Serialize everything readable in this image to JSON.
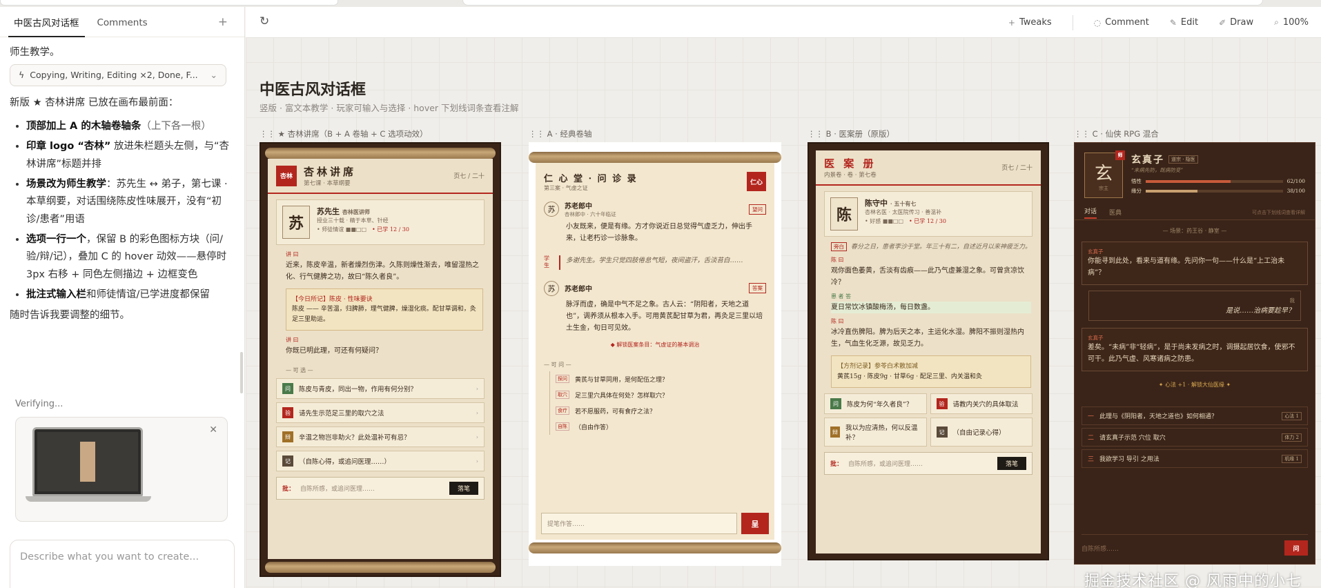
{
  "sidebar": {
    "tabs": [
      "中医古风对话框",
      "Comments"
    ],
    "tab_plus": "+",
    "chat_head": "师生教学。",
    "tooluse_label": "Copying, Writing, Editing ×2, Done, F...",
    "lead": "新版 ★ 杏林讲席 已放在画布最前面：",
    "bullets": [
      {
        "b": "顶部加上 A 的木轴卷轴条",
        "t": "（上下各一根）"
      },
      {
        "b": "印章 logo “杏林”",
        "t": " 放进朱栏题头左侧，与“杏林讲席”标题并排"
      },
      {
        "b": "场景改为师生教学",
        "t": "：苏先生 ↔ 弟子，第七课 · 本草纲要，对话围绕陈皮性味展开，没有“初诊/患者”用语"
      },
      {
        "b": "选项一行一个",
        "t": "，保留 B 的彩色图标方块（问/验/辩/记），叠加 C 的 hover 动效——悬停时 3px 右移 + 同色左侧描边 + 边框变色"
      },
      {
        "b": "批注式输入栏",
        "t": "和师徒情谊/已学进度都保留"
      }
    ],
    "closing": "随时告诉我要调整的细节。",
    "verifying": "Verifying...",
    "composer_placeholder": "Describe what you want to create..."
  },
  "toolbar": {
    "tweaks": "Tweaks",
    "comment": "Comment",
    "edit": "Edit",
    "draw": "Draw",
    "zoom": "100%"
  },
  "canvas": {
    "title": "中医古风对话框",
    "subtitle": "竖版 · 富文本教学 · 玩家可输入与选择 · hover 下划线词条查看注解",
    "labels": [
      "★ 杏林讲席（B + A 卷轴 + C 选项动效）",
      "A · 经典卷轴",
      "B · 医案册（原版）",
      "C · 仙侠 RPG 混合"
    ]
  },
  "artA": {
    "seal": "杏林",
    "title": "杏林讲席",
    "sub": "第七课 · 本草纲要",
    "page": "页七 / 二十",
    "pic": "苏",
    "pic_sub": "主讲",
    "name": "苏先生",
    "name_tag": "杏林医讲师",
    "desc": "授业三十载 · 精于本草、针经",
    "stat1": "• 师徒情谊 ■■□□",
    "stat2": "• 已学 12 / 30",
    "lbl1": "讲 曰",
    "text1": "近来，陈皮辛温，新者燥烈伤津。久陈则燥性渐去，唯留湿热之化、行气健脾之功，故曰“陈久者良”。",
    "note_title": "【今日所记】陈皮 · 性味要诀",
    "note_text": "陈皮 —— 辛苦温，归脾肺，理气健脾，燥湿化痰。配甘草调和，灸足三里助运。",
    "lbl2": "讲 曰",
    "text2": "你既已明此理，可还有何疑问？",
    "opts_head": "— 可 选 —",
    "opts": [
      {
        "k": "问",
        "t": "陈皮与青皮，同出一物，作用有何分别？",
        "c": "#4a7a4a"
      },
      {
        "k": "验",
        "t": "请先生示范足三里的取穴之法",
        "c": "#b3261e"
      },
      {
        "k": "辩",
        "t": "辛温之物岂非助火？此处温补可有忌？",
        "c": "#a07028"
      },
      {
        "k": "记",
        "t": "（自陈心得，或追问医理……）",
        "c": "#5a4a3a"
      }
    ],
    "input_label": "批：",
    "input_placeholder": "自陈所感，或追问医理……",
    "input_btn": "落笔"
  },
  "artB": {
    "title": "仁 心 堂 · 问 诊 录",
    "sub": "第三案 · 气虚之证",
    "seal": "仁心",
    "name1": "苏老郎中",
    "name1_sub": "杏林郎中 · 六十年临证",
    "tag1": "望问",
    "text1": "小友既来，便是有缘。方才你说近日总觉得气虚乏力，伸出手来，让老朽诊一诊脉象。",
    "stu_lbl": "学 生",
    "stu_text": "多谢先生。学生只觉四肢倦怠气短，夜间盗汗，舌淡苔白……",
    "name2": "苏老郎中",
    "tag2": "答案",
    "text2": "脉浮而虚，确是中气不足之象。古人云：“阴阳者，天地之道也”，调养须从根本入手。可用黄芪配甘草为君，再灸足三里以培土生金，旬日可见效。",
    "unlock": "◆ 解锁医案条目：气虚证的基本调治",
    "opts_head": "— 可 问 —",
    "opts": [
      {
        "k": "探问",
        "t": "黄芪与甘草同用，是何配伍之理？"
      },
      {
        "k": "取穴",
        "t": "足三里穴具体在何处？怎样取穴？"
      },
      {
        "k": "食疗",
        "t": "若不愿服药，可有食疗之法？"
      },
      {
        "k": "自陈",
        "t": "（自由作答）"
      }
    ],
    "input_placeholder": "提笔作答……",
    "input_btn": "呈"
  },
  "artC": {
    "title": "医 案 册",
    "sub": "内景卷 · 卷 · 第七卷",
    "page": "页七 / 二十",
    "pic": "陈",
    "name": "陈守中",
    "name_tag": "· 五十有七",
    "desc": "杏林名医 · 太医院传习 · 善温补",
    "stat1": "• 好感 ■■□□",
    "stat2": "• 已学 12 / 30",
    "tag_a": "旁白",
    "text_a": "春分之日，患者李沙于堂。年三十有二，自述近月以来神疲乏力。",
    "lbl1": "陈 曰",
    "text1": "观你面色萎黄，舌淡有齿痕——此乃气虚兼湿之象。可曾贪凉饮冷？",
    "lbl2": "患 者 答",
    "text2": "夏日常饮冰镇酸梅汤，每日数盏。",
    "lbl3": "陈 曰",
    "text3": "冰冷直伤脾阳。脾为后天之本，主运化水湿。脾阳不振则湿热内生，气血生化乏源，故见乏力。",
    "note_title": "【方剂记录】参苓白术散加减",
    "note_text": "黄芪15g · 陈皮9g · 甘草6g · 配足三里、内关温和灸",
    "opts": [
      {
        "k": "问",
        "t": "陈皮为何“年久者良”？",
        "c": "#4a7a4a"
      },
      {
        "k": "验",
        "t": "请教内关穴的具体取法",
        "c": "#b3261e"
      },
      {
        "k": "辩",
        "t": "我以为应清热，何以反温补？",
        "c": "#a07028"
      },
      {
        "k": "记",
        "t": "（自由记录心得）",
        "c": "#5a4a3a"
      }
    ],
    "input_label": "批：",
    "input_placeholder": "自陈所感，或追问医理……",
    "input_btn": "落笔"
  },
  "artD": {
    "pic": "玄",
    "pic_sub": "宗主",
    "badge": "师",
    "name": "玄真子",
    "name_tag": "道宗 · 隐医",
    "motto": "“未病先防，既病防变”",
    "bar1_lbl": "悟性",
    "bar1_val": "62/100",
    "bar1_pct": 62,
    "bar2_lbl": "缘分",
    "bar2_val": "38/100",
    "bar2_pct": 38,
    "tabs": [
      "对话",
      "医典"
    ],
    "hint": "可点击下划线词查看详解",
    "loc": "— 场景：药王谷 · 静室 —",
    "sp1": "玄真子",
    "text1": "你能寻到此处，看来与道有缘。先问你一句——什么是“上工治未病”？",
    "reply_lbl": "我",
    "reply": "是说……治病要趁早？",
    "sp2": "玄真子",
    "text2": "差矣。“未病”非“轻病”，是于尚未发病之时，调摄起居饮食，使邪不可干。此乃气虚、风寒诸病之防患。",
    "divider": "✦ 心法 +1 · 解锁大仙医缘 ✦",
    "opts": [
      {
        "k": "一",
        "t": "此理与《阴阳者，天地之道也》如何相通？",
        "tag": "心法 1"
      },
      {
        "k": "二",
        "t": "请玄真子示范 穴位 取穴",
        "tag": "体力 2"
      },
      {
        "k": "三",
        "t": "我欲学习 导引 之用法",
        "tag": "机缘 1"
      }
    ],
    "input_placeholder": "自陈所感……",
    "input_btn": "问"
  },
  "watermark": "掘金技术社区 @ 风雨中的小七"
}
